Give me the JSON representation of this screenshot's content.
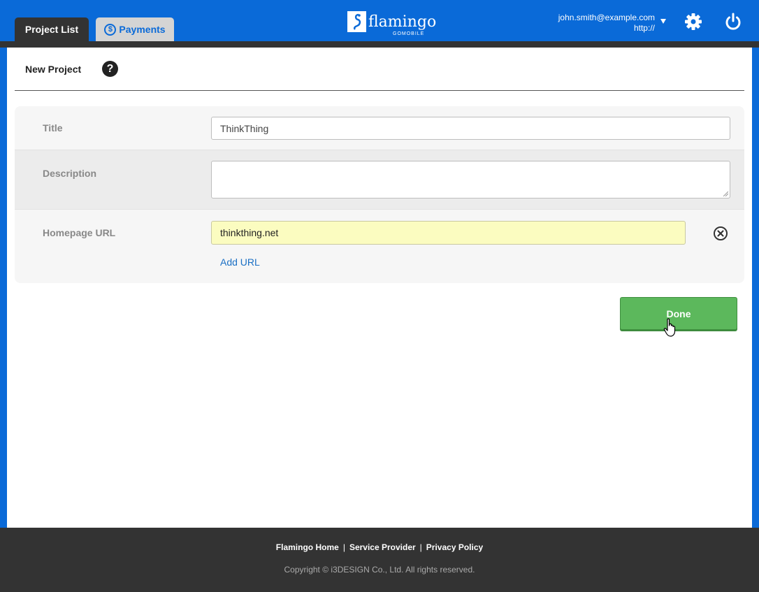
{
  "header": {
    "tabs": [
      {
        "label": "Project List",
        "active": true
      },
      {
        "label": "Payments",
        "icon": "dollar-circle-icon",
        "active": false
      }
    ],
    "logo_text": "flamingo",
    "logo_sub": "GOMOBILE",
    "user_email": "john.smith@example.com",
    "user_url": "http://",
    "settings_icon": "gear-icon",
    "logout_icon": "power-icon"
  },
  "page": {
    "title": "New Project",
    "help_icon": "question-icon"
  },
  "form": {
    "title_label": "Title",
    "title_value": "ThinkThing",
    "description_label": "Description",
    "description_value": "",
    "homepage_label": "Homepage URL",
    "homepage_value": "thinkthing.net",
    "add_url_label": "Add URL"
  },
  "actions": {
    "done_label": "Done"
  },
  "footer": {
    "links": [
      "Flamingo Home",
      "Service Provider",
      "Privacy Policy"
    ],
    "copyright": "Copyright © i3DESIGN Co., Ltd. All rights reserved."
  },
  "colors": {
    "brand_blue": "#0a6ad8",
    "dark": "#333333",
    "done_green": "#5cb85c",
    "url_highlight": "#fbfcc0",
    "link_blue": "#1a6fc4"
  }
}
